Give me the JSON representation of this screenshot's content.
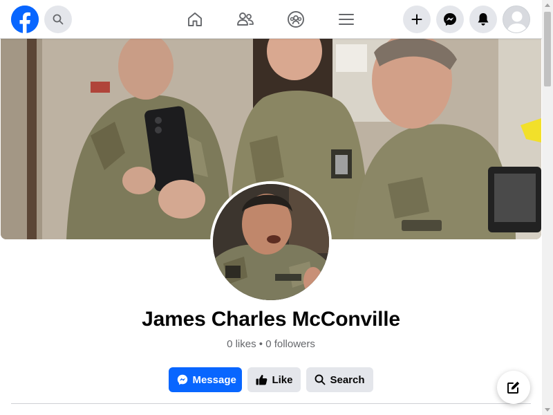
{
  "nav": {
    "icons": [
      "facebook-logo-icon",
      "search-icon",
      "home-icon",
      "friends-icon",
      "groups-icon",
      "menu-icon",
      "plus-icon",
      "messenger-icon",
      "bell-icon",
      "avatar-icon"
    ]
  },
  "page": {
    "name": "James Charles McConville",
    "stats": "0 likes • 0 followers"
  },
  "actions": {
    "message_label": "Message",
    "like_label": "Like",
    "search_label": "Search"
  },
  "colors": {
    "brand": "#0866ff",
    "secondary_button": "#e4e6eb",
    "muted_text": "#65676b"
  }
}
